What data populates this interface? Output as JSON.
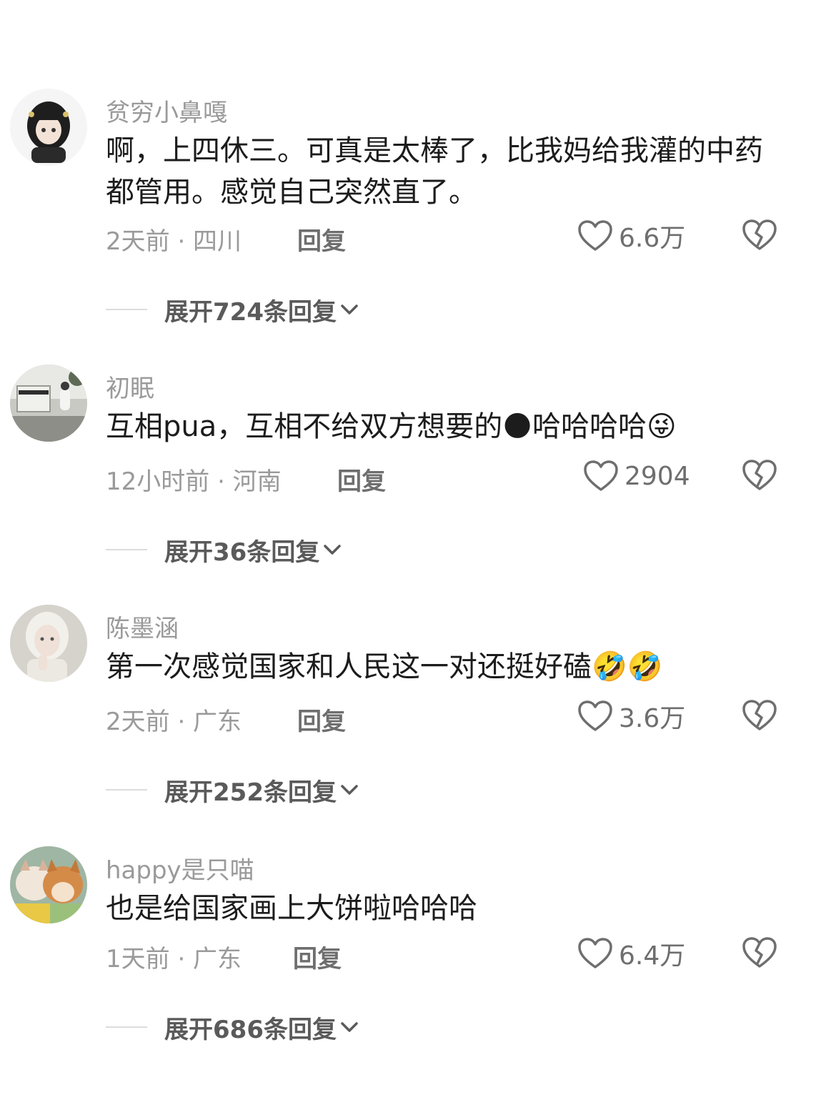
{
  "comments": [
    {
      "username": "贫穷小鼻嘎",
      "text": "啊，上四休三。可真是太棒了，比我妈给我灌的中药都管用。感觉自己突然直了。",
      "emojis": "",
      "time_location": "2天前 · 四川",
      "reply_label": "回复",
      "likes": "6.6万",
      "expand_label": "展开724条回复",
      "avatar_icon": "anime-girl-avatar"
    },
    {
      "username": "初眠",
      "text": "互相pua，互相不给双方想要的",
      "emojis": "🌑哈哈哈哈😜",
      "time_location": "12小时前 · 河南",
      "reply_label": "回复",
      "likes": "2904",
      "expand_label": "展开36条回复",
      "avatar_icon": "piano-room-avatar"
    },
    {
      "username": "陈墨涵",
      "text": "第一次感觉国家和人民这一对还挺好磕",
      "emojis": "🤣🤣",
      "time_location": "2天前 · 广东",
      "reply_label": "回复",
      "likes": "3.6万",
      "expand_label": "展开252条回复",
      "avatar_icon": "white-hair-person-avatar"
    },
    {
      "username": "happy是只喵",
      "text": "也是给国家画上大饼啦哈哈哈",
      "emojis": "",
      "time_location": "1天前 · 广东",
      "reply_label": "回复",
      "likes": "6.4万",
      "expand_label": "展开686条回复",
      "avatar_icon": "cat-and-dog-avatar"
    }
  ],
  "icons": {
    "like": "heart-outline-icon",
    "dislike": "broken-heart-icon",
    "expand": "chevron-down-icon"
  },
  "colors": {
    "username": "#9a9a9a",
    "text": "#1c1c1c",
    "secondary": "#6e6e6e"
  }
}
